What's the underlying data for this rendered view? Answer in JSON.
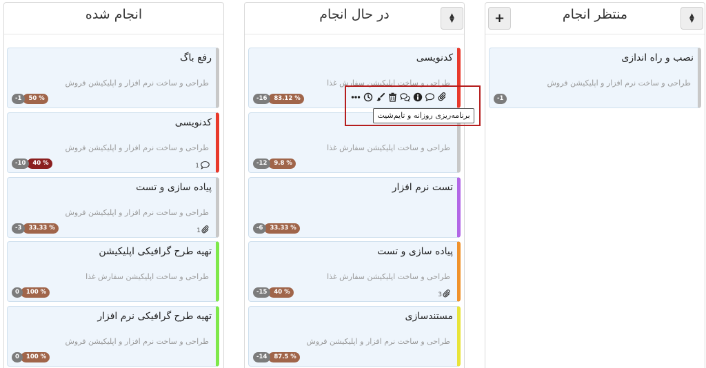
{
  "columns": {
    "done": {
      "title": "انجام شده",
      "cards": [
        {
          "title": "رفع باگ",
          "subtitle": "طراحی و ساخت نرم افزار و اپلیکیشن فروش",
          "count": "-1",
          "percent": "50 %",
          "color": "#c8c8c8"
        },
        {
          "title": "کدنویسی",
          "subtitle": "طراحی و ساخت نرم افزار و اپلیکیشن فروش",
          "count": "-10",
          "percent": "40 %",
          "color": "#e8392b",
          "comments": "1"
        },
        {
          "title": "پیاده سازی و تست",
          "subtitle": "طراحی و ساخت نرم افزار و اپلیکیشن فروش",
          "count": "-3",
          "percent": "33.33 %",
          "color": "#c8c8c8",
          "attachments": "1"
        },
        {
          "title": "تهیه طرح گرافیکی اپلیکیشن",
          "subtitle": "طراحی و ساخت اپلیکیشن سفارش غذا",
          "count": "0",
          "percent": "100 %",
          "color": "#7ee84a"
        },
        {
          "title": "تهیه طرح گرافیکی نرم افزار",
          "subtitle": "طراحی و ساخت نرم افزار و اپلیکیشن فروش",
          "count": "0",
          "percent": "100 %",
          "color": "#7ee84a"
        }
      ]
    },
    "in_progress": {
      "title": "در حال انجام",
      "cards": [
        {
          "title": "کدنویسی",
          "subtitle": "طراحی و ساخت اپلیکیشن سفارش غذا",
          "count": "-16",
          "percent": "83.12 %",
          "color": "#e8392b"
        },
        {
          "title": "",
          "subtitle": "طراحی و ساخت اپلیکیشن سفارش غذا",
          "count": "-12",
          "percent": "9.8 %",
          "color": "#c8c8c8"
        },
        {
          "title": "تست نرم افزار",
          "subtitle": "",
          "count": "-6",
          "percent": "33.33 %",
          "color": "#b267e6"
        },
        {
          "title": "پیاده سازی و تست",
          "subtitle": "طراحی و ساخت اپلیکیشن سفارش غذا",
          "count": "-15",
          "percent": "40 %",
          "color": "#f0922b",
          "attachments": "3"
        },
        {
          "title": "مستندسازی",
          "subtitle": "طراحی و ساخت نرم افزار و اپلیکیشن فروش",
          "count": "-14",
          "percent": "87.5 %",
          "color": "#e8e43a"
        }
      ]
    },
    "waiting": {
      "title": "منتظر انجام",
      "cards": [
        {
          "title": "نصب و راه اندازی",
          "subtitle": "طراحی و ساخت نرم افزار و اپلیکیشن فروش",
          "count": "-1",
          "color": "#c8c8c8"
        }
      ]
    }
  },
  "header_buttons": {
    "add": "+"
  },
  "toolbar_icons": [
    "more-icon",
    "clock-icon",
    "brush-icon",
    "trash-icon",
    "comments-icon",
    "info-icon",
    "comment-icon",
    "paperclip-icon"
  ],
  "tooltip": "برنامه‌ریزی روزانه و تایم‌شیت"
}
